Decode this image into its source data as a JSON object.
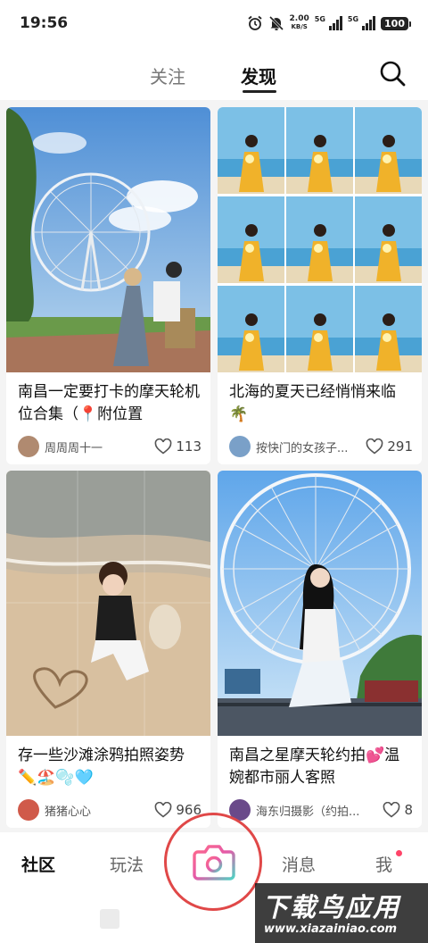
{
  "status_bar": {
    "time": "19:56",
    "speed_value": "2.00",
    "speed_unit": "KB/S",
    "network_1": "5G",
    "network_2": "5G",
    "battery": "100"
  },
  "header": {
    "tabs": [
      {
        "label": "关注",
        "active": false
      },
      {
        "label": "发现",
        "active": true
      }
    ],
    "search_icon": "search-icon"
  },
  "feed": {
    "cards": [
      {
        "title": "南昌一定要打卡的摩天轮机位合集（📍附位置",
        "author": "周周周十一",
        "likes": "113",
        "image": "ferris-wheel-couple-photo",
        "avatar_color": "#b08a70"
      },
      {
        "title": "北海的夏天已经悄悄来临🌴",
        "author": "按快门的女孩子...",
        "likes": "291",
        "image": "beach-yellow-dress-grid",
        "avatar_color": "#7aa0c8"
      },
      {
        "title": "存一些沙滩涂鸦拍照姿势✏️🏖️🫧🩵",
        "author": "猪猪心心",
        "likes": "966",
        "image": "beach-heart-drawing-photo",
        "avatar_color": "#d05a4a"
      },
      {
        "title": "南昌之星摩天轮约拍💕温婉都市丽人客照",
        "author": "海东归摄影（约拍...",
        "likes": "8",
        "image": "ferris-wheel-woman-photo",
        "avatar_color": "#6a4a8a"
      }
    ]
  },
  "bottom_nav": {
    "items": [
      {
        "label": "社区",
        "active": true
      },
      {
        "label": "玩法",
        "active": false
      },
      {
        "label": "消息",
        "active": false
      },
      {
        "label": "我",
        "active": false
      }
    ],
    "camera_icon": "camera-icon",
    "highlight_color": "#e04848"
  },
  "watermark": {
    "logo": "下载鸟应用",
    "url": "www.xiazainiao.com"
  }
}
